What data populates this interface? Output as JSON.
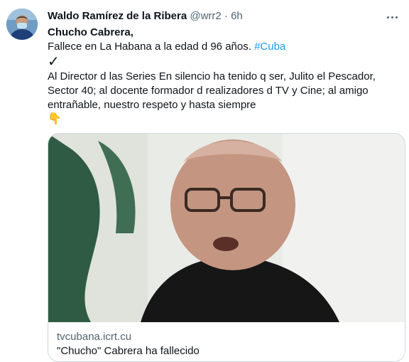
{
  "tweet": {
    "display_name": "Waldo Ramírez de la Ribera",
    "handle": "@wrr2",
    "separator": "·",
    "time": "6h",
    "avatar_icon": "person-with-mask-avatar",
    "more_icon": "more-options-icon",
    "text": {
      "title": "Chucho Cabrera,",
      "line1": "Fallece en La Habana a la edad d 96 años. ",
      "hashtag": "#Cuba",
      "check": "✓",
      "line2": "Al Director d las Series En silencio ha tenido q ser, Julito el Pescador,",
      "line3": "Sector 40; al docente formador d realizadores d TV y Cine; al amigo",
      "line4": "entrañable, nuestro respeto y hasta siempre",
      "emoji": "👇"
    },
    "card": {
      "domain": "tvcubana.icrt.cu",
      "title": "\"Chucho\" Cabrera ha fallecido"
    }
  },
  "colors": {
    "link": "#1d9bf0",
    "secondary_text": "#536471",
    "border": "#cfd9de"
  }
}
